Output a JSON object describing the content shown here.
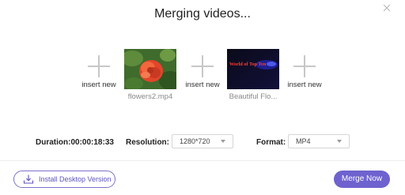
{
  "dialog": {
    "title": "Merging videos...",
    "close_icon": "close-icon"
  },
  "clips": {
    "insert_label": "insert new",
    "items": [
      {
        "name": "flowers2.mp4",
        "thumbnail": "rose-flower-photo"
      },
      {
        "name": "Beautiful Flo...",
        "thumbnail": "world-of-top-title-card",
        "thumbnail_text": "World of Top Ten"
      }
    ]
  },
  "settings": {
    "duration_label": "Duration:",
    "duration_value": "00:00:18:33",
    "resolution_label": "Resolution:",
    "resolution_value": "1280*720",
    "format_label": "Format:",
    "format_value": "MP4"
  },
  "footer": {
    "install_label": "Install Desktop Version",
    "install_icon": "download-icon",
    "merge_label": "Merge Now"
  },
  "colors": {
    "accent": "#6e62cf",
    "accent_text": "#5d54bd",
    "plus": "#c7c7c7"
  }
}
